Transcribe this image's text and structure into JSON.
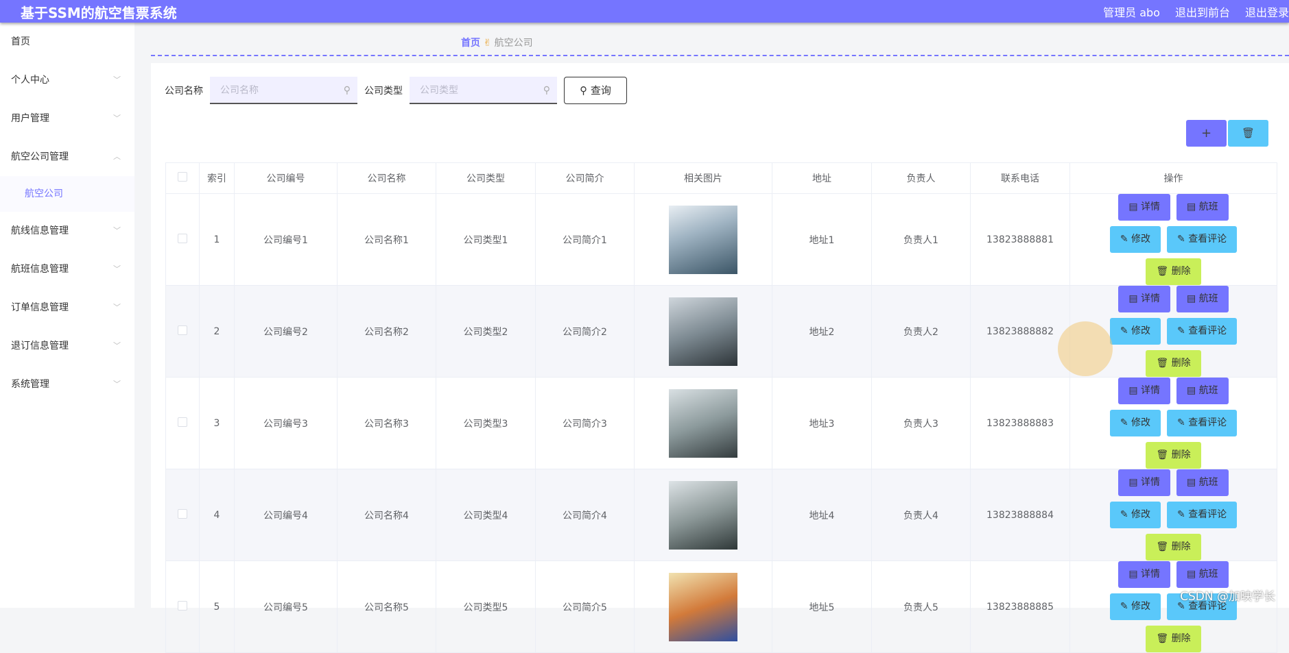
{
  "header": {
    "title": "基于SSM的航空售票系统",
    "user": "管理员 abo",
    "front": "退出到前台",
    "logout": "退出登录"
  },
  "sidebar": {
    "items": [
      {
        "label": "首页"
      },
      {
        "label": "个人中心"
      },
      {
        "label": "用户管理"
      },
      {
        "label": "航空公司管理"
      },
      {
        "label": "航空公司"
      },
      {
        "label": "航线信息管理"
      },
      {
        "label": "航班信息管理"
      },
      {
        "label": "订单信息管理"
      },
      {
        "label": "退订信息管理"
      },
      {
        "label": "系统管理"
      }
    ]
  },
  "breadcrumb": {
    "home": "首页",
    "current": "航空公司"
  },
  "search": {
    "name_label": "公司名称",
    "name_placeholder": "公司名称",
    "type_label": "公司类型",
    "type_placeholder": "公司类型",
    "query": "查询"
  },
  "table": {
    "headers": [
      "索引",
      "公司编号",
      "公司名称",
      "公司类型",
      "公司简介",
      "相关图片",
      "地址",
      "负责人",
      "联系电话",
      "操作"
    ],
    "rows": [
      [
        "1",
        "公司编号1",
        "公司名称1",
        "公司类型1",
        "公司简介1",
        "地址1",
        "负责人1",
        "13823888881"
      ],
      [
        "2",
        "公司编号2",
        "公司名称2",
        "公司类型2",
        "公司简介2",
        "地址2",
        "负责人2",
        "13823888882"
      ],
      [
        "3",
        "公司编号3",
        "公司名称3",
        "公司类型3",
        "公司简介3",
        "地址3",
        "负责人3",
        "13823888883"
      ],
      [
        "4",
        "公司编号4",
        "公司名称4",
        "公司类型4",
        "公司简介4",
        "地址4",
        "负责人4",
        "13823888884"
      ],
      [
        "5",
        "公司编号5",
        "公司名称5",
        "公司类型5",
        "公司简介5",
        "地址5",
        "负责人5",
        "13823888885"
      ]
    ],
    "actions": {
      "detail": "详情",
      "flight": "航班",
      "edit": "修改",
      "comments": "查看评论",
      "delete": "删除"
    }
  },
  "watermark": "CSDN @加映学长"
}
